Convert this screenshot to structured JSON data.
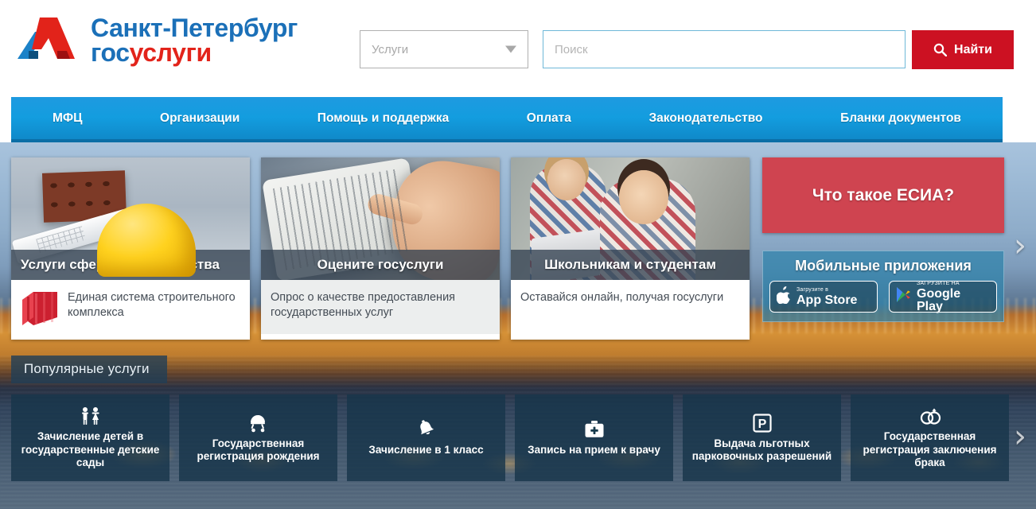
{
  "header": {
    "logo": {
      "line1": "Санкт-Петербург",
      "line2_gos": "гос",
      "line2_uslugi": "услуги",
      "mark_name": "spb-gosuslugi-logo"
    },
    "search": {
      "select_value": "Услуги",
      "select_caret_icon": "chevron-down-icon",
      "input_placeholder": "Поиск",
      "input_value": "",
      "button_label": "Найти",
      "button_icon": "search-icon",
      "button_color": "#cc1122"
    }
  },
  "nav": {
    "items": [
      {
        "label": "МФЦ"
      },
      {
        "label": "Организации"
      },
      {
        "label": "Помощь и поддержка"
      },
      {
        "label": "Оплата"
      },
      {
        "label": "Законодательство"
      },
      {
        "label": "Бланки документов"
      }
    ],
    "color": "#139ddf"
  },
  "cards": [
    {
      "title": "Услуги сферы строительства",
      "description": "Единая система строительного комплекса",
      "icon": "red-cube-icon",
      "media": "construction-photo"
    },
    {
      "title": "Оцените госуслуги",
      "description": "Опрос о качестве предоставления государственных услуг",
      "media": "tablet-photo"
    },
    {
      "title": "Школьникам и студентам",
      "description": "Оставайся онлайн, получая госуслуги",
      "media": "students-photo"
    }
  ],
  "right_column": {
    "esia": {
      "title": "Что такое ЕСИА?",
      "color": "#cf4450"
    },
    "apps": {
      "title": "Мобильные приложения",
      "badges": [
        {
          "small": "Загрузите в",
          "big": "App Store",
          "icon": "apple-icon"
        },
        {
          "small": "ЗАГРУЗИТЕ НА",
          "big": "Google Play",
          "icon": "google-play-icon"
        }
      ]
    }
  },
  "popular": {
    "label": "Популярные услуги",
    "tiles": [
      {
        "label": "Зачисление детей в государственные детские сады",
        "icon": "children-icon"
      },
      {
        "label": "Государственная регистрация рождения",
        "icon": "stroller-icon"
      },
      {
        "label": "Зачисление в 1 класс",
        "icon": "bell-icon"
      },
      {
        "label": "Запись на прием к врачу",
        "icon": "medical-bag-icon"
      },
      {
        "label": "Выдача льготных парковочных разрешений",
        "icon": "parking-icon"
      },
      {
        "label": "Государственная регистрация заключения брака",
        "icon": "wedding-rings-icon"
      }
    ]
  },
  "carousel": {
    "cards_next_arrow": "›",
    "tiles_next_arrow": "›"
  }
}
